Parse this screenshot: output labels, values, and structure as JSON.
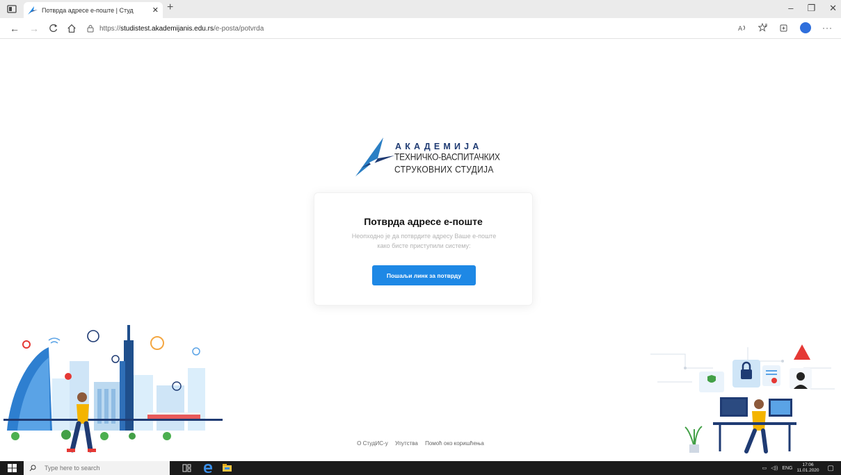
{
  "browser": {
    "tab_title": "Потврда адресе е-поште | Студ",
    "url_prefix": "https://",
    "url_host": "studistest.akademijanis.edu.rs",
    "url_path": "/e-posta/potvrda"
  },
  "logo": {
    "line1": "АКАДЕМИЈА",
    "line2": "ТЕХНИЧКО-ВАСПИТАЧКИХ",
    "line3": "СТРУКОВНИХ СТУДИЈА"
  },
  "card": {
    "title": "Потврда адресе е-поште",
    "text_line1": "Неопходно је да потврдите адресу Ваше е-поште",
    "text_line2": "како бисте приступили систему:",
    "button_label": "Пошаљи линк за потврду"
  },
  "footer": {
    "links": [
      "О СтудИС-у",
      "Упутства",
      "Помоћ око коришћења"
    ]
  },
  "taskbar": {
    "search_placeholder": "Type here to search",
    "language": "ENG",
    "time": "17:06",
    "date": "11.01.2020"
  },
  "colors": {
    "primary_button": "#1e88e5",
    "logo_blue": "#1f3b73"
  }
}
